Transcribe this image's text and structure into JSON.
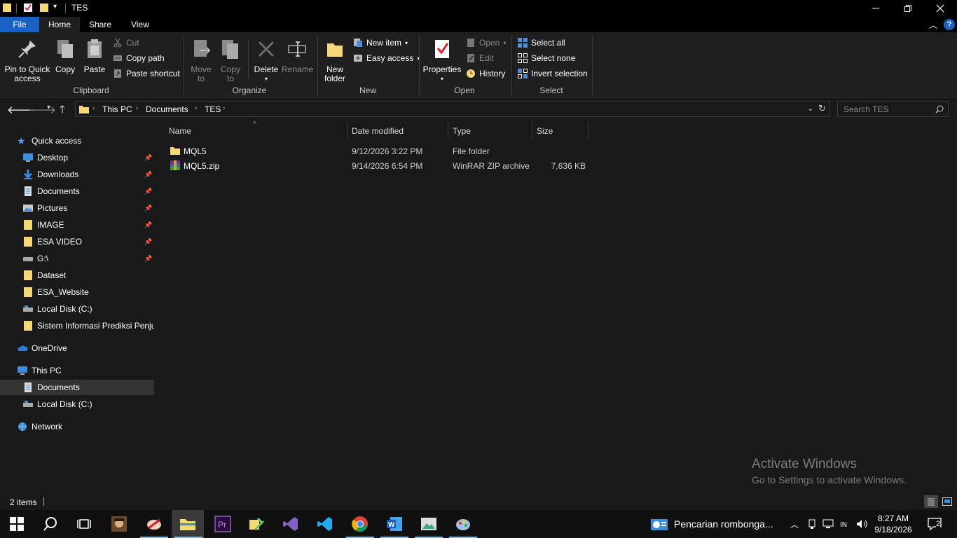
{
  "window": {
    "title": "TES"
  },
  "ribbon_tabs": [
    "File",
    "Home",
    "Share",
    "View"
  ],
  "ribbon": {
    "clipboard": {
      "pin": "Pin to Quick\naccess",
      "copy": "Copy",
      "paste": "Paste",
      "cut": "Cut",
      "copy_path": "Copy path",
      "paste_shortcut": "Paste shortcut",
      "group": "Clipboard"
    },
    "organize": {
      "move_to": "Move\nto",
      "copy_to": "Copy\nto",
      "delete": "Delete",
      "rename": "Rename",
      "group": "Organize"
    },
    "new": {
      "new_folder": "New\nfolder",
      "new_item": "New item",
      "easy_access": "Easy access",
      "group": "New"
    },
    "open": {
      "properties": "Properties",
      "open": "Open",
      "edit": "Edit",
      "history": "History",
      "group": "Open"
    },
    "select": {
      "select_all": "Select all",
      "select_none": "Select none",
      "invert": "Invert selection",
      "group": "Select"
    }
  },
  "address": {
    "crumbs": [
      "This PC",
      "Documents",
      "TES"
    ]
  },
  "search": {
    "placeholder": "Search TES"
  },
  "nav": {
    "quick_access": "Quick access",
    "pinned": [
      "Desktop",
      "Downloads",
      "Documents",
      "Pictures",
      "IMAGE",
      "ESA VIDEO",
      "G:\\"
    ],
    "recent": [
      "Dataset",
      "ESA_Website",
      "Local Disk (C:)",
      "Sistem Informasi Prediksi Penjualan"
    ],
    "onedrive": "OneDrive",
    "this_pc": "This PC",
    "this_pc_items": [
      "Documents",
      "Local Disk (C:)"
    ],
    "network": "Network"
  },
  "columns": [
    "Name",
    "Date modified",
    "Type",
    "Size"
  ],
  "files": [
    {
      "name": "MQL5",
      "date": "9/12/2026 3:22 PM",
      "type": "File folder",
      "size": ""
    },
    {
      "name": "MQL5.zip",
      "date": "9/14/2026 6:54 PM",
      "type": "WinRAR ZIP archive",
      "size": "7,636 KB"
    }
  ],
  "watermark": {
    "line1": "Activate Windows",
    "line2": "Go to Settings to activate Windows."
  },
  "status": {
    "count": "2 items"
  },
  "taskbar": {
    "notification": "Pencarian rombonga...",
    "time": "8:27 AM",
    "date": "9/18/2026",
    "action_center_count": "2"
  },
  "colors": {
    "accent": "#1a62c4",
    "folder": "#f8d775",
    "background": "#191919"
  }
}
